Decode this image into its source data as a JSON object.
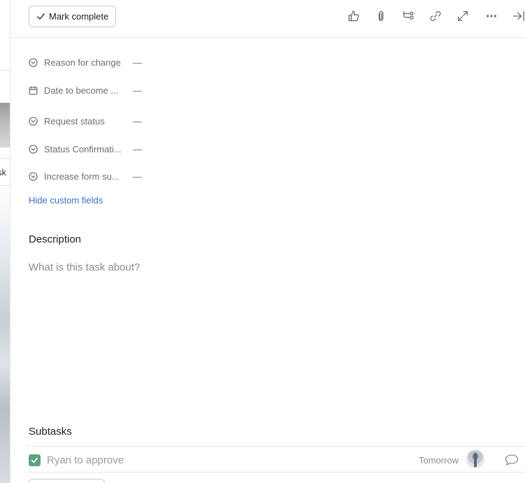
{
  "toolbar": {
    "mark_complete_label": "Mark complete",
    "icons": [
      "thumbs-up-icon",
      "attachment-icon",
      "subtask-icon",
      "link-icon",
      "expand-icon",
      "more-icon",
      "close-panel-icon"
    ]
  },
  "custom_fields": [
    {
      "icon": "chevron-circle-icon",
      "label": "Reason for change",
      "value": "—"
    },
    {
      "icon": "calendar-icon",
      "label": "Date to become ...",
      "value": "—"
    },
    {
      "icon": "chevron-circle-icon",
      "label": "Request status",
      "value": "—"
    },
    {
      "icon": "chevron-circle-icon",
      "label": "Status Confirmati...",
      "value": "—"
    },
    {
      "icon": "chevron-circle-icon",
      "label": "Increase form su...",
      "value": "—"
    }
  ],
  "hide_custom_fields_label": "Hide custom fields",
  "description": {
    "title": "Description",
    "placeholder": "What is this task about?"
  },
  "subtasks": {
    "title": "Subtasks",
    "items": [
      {
        "name": "Ryan to approve",
        "due": "Tomorrow",
        "completed": true
      }
    ]
  },
  "background": {
    "visible_text": "sk"
  },
  "colors": {
    "link": "#3b6fc7",
    "check_green": "#5da283",
    "muted_text": "#6d6e6f"
  }
}
